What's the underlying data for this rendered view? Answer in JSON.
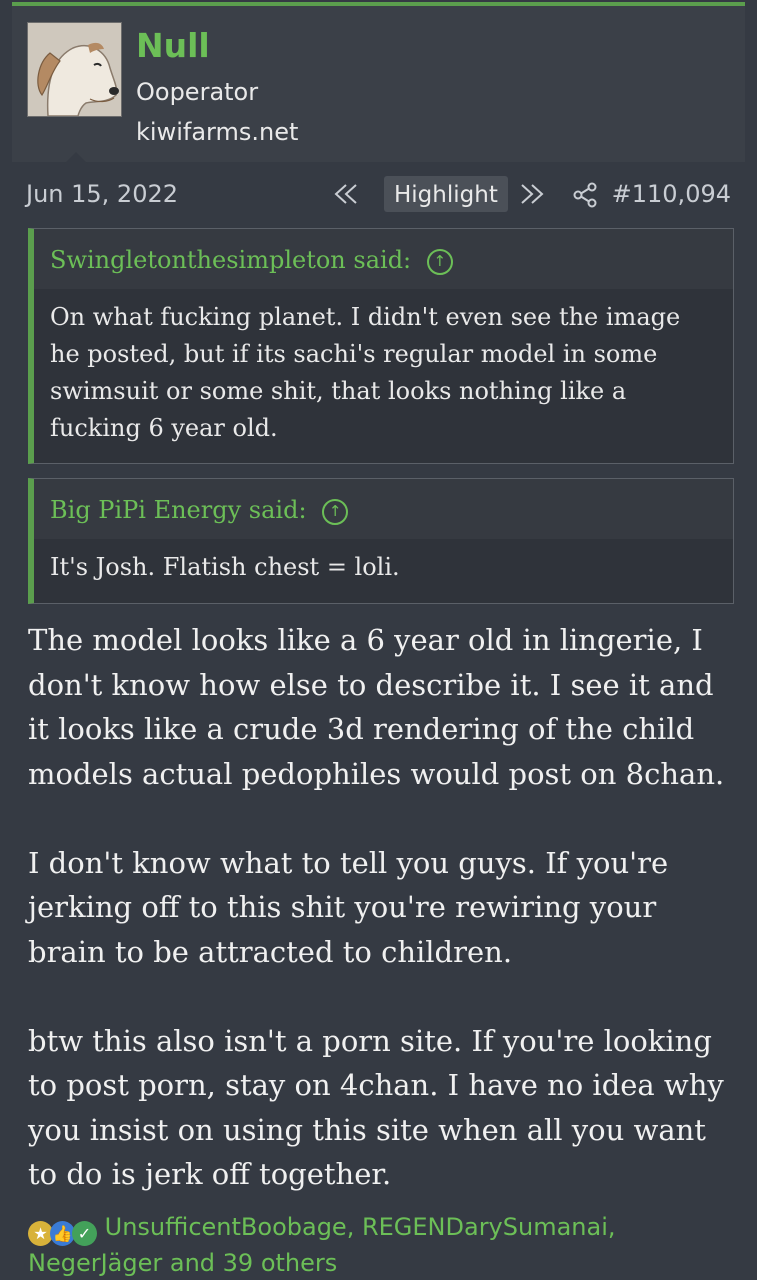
{
  "user": {
    "name": "Null",
    "title": "Ooperator",
    "banner": "kiwifarms.net"
  },
  "meta": {
    "date": "Jun 15, 2022",
    "highlight_label": "Highlight",
    "post_number": "#110,094"
  },
  "quotes": [
    {
      "author_line": "Swingletonthesimpleton said:",
      "text": "On what fucking planet. I didn't even see the image he posted, but if its sachi's regular model in some swimsuit or some shit, that looks nothing like a fucking 6 year old."
    },
    {
      "author_line": "Big PiPi Energy said:",
      "text": "It's Josh. Flatish chest = loli."
    }
  ],
  "body": {
    "p1": "The model looks like a 6 year old in lingerie, I don't know how else to describe it. I see it and it looks like a crude 3d rendering of the child models actual pedophiles would post on 8chan.",
    "p2": "I don't know what to tell you guys. If you're jerking off to this shit you're rewiring your brain to be attracted to children.",
    "p3": "btw this also isn't a porn site. If you're looking to post porn, stay on 4chan. I have no idea why you insist on using this site when all you want to do is jerk off together."
  },
  "reactions": {
    "text": "UnsufficentBoobage, REGENDarySumanai, NegerJäger and 39 others",
    "icons": [
      "medal-icon",
      "thumbs-up-icon",
      "checkmark-icon"
    ]
  },
  "colors": {
    "accent": "#6cbf57",
    "background": "#353a43",
    "userbar": "#3b4048"
  }
}
